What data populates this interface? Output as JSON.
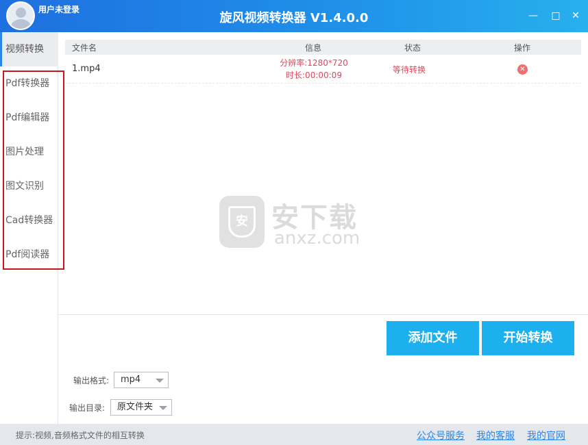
{
  "titlebar": {
    "user_label": "用户未登录",
    "title": "旋风视频转换器 V1.4.0.0",
    "minimize": "—",
    "maximize": "□",
    "close": "✕"
  },
  "sidebar": {
    "items": [
      {
        "label": "视频转换",
        "active": true
      },
      {
        "label": "Pdf转换器"
      },
      {
        "label": "Pdf编辑器"
      },
      {
        "label": "图片处理"
      },
      {
        "label": "图文识别"
      },
      {
        "label": "Cad转换器"
      },
      {
        "label": "Pdf阅读器"
      }
    ]
  },
  "table": {
    "headers": [
      "文件名",
      "信息",
      "状态",
      "操作"
    ],
    "rows": [
      {
        "name": "1.mp4",
        "resolution": "分辨率:1280*720",
        "duration": "时长:00:00:09",
        "status": "等待转换"
      }
    ]
  },
  "watermark": {
    "shield_char": "安",
    "brand": "安下载",
    "url": "anxz.com"
  },
  "actions": {
    "add_label": "添加文件",
    "start_label": "开始转换"
  },
  "output": {
    "format_label": "输出格式:",
    "format_value": "mp4",
    "dir_label": "输出目录:",
    "dir_value": "原文件夹"
  },
  "footer": {
    "hint": "提示:视频,音频格式文件的相互转换",
    "links": [
      "公众号服务",
      "我的客服",
      "我的官网"
    ]
  },
  "colors": {
    "accent": "#1cb0ee",
    "titlebar_start": "#1e6fe0",
    "titlebar_end": "#27b0ee",
    "status_red": "#e0465a",
    "highlight_red": "#c8161d"
  }
}
